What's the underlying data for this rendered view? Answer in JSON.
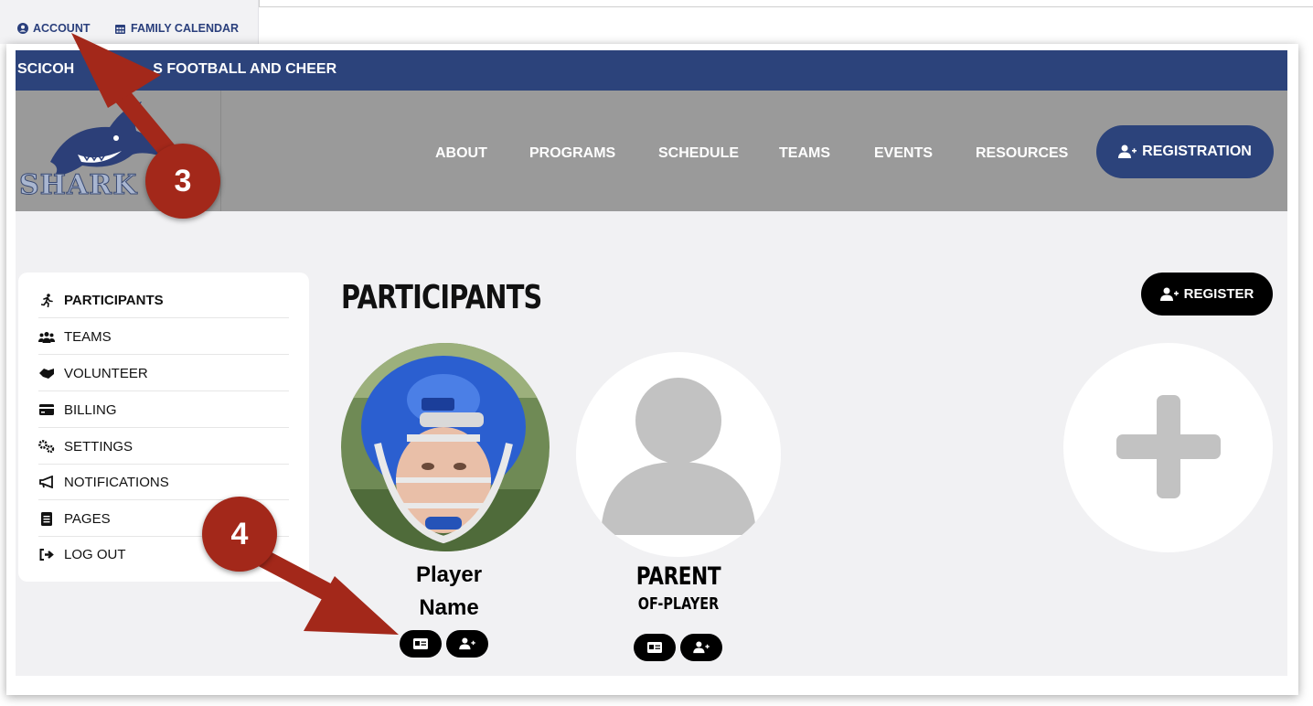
{
  "top_links": {
    "account": "ACCOUNT",
    "family_calendar": "FAMILY CALENDAR"
  },
  "banner": {
    "org_name_start": "SCICOH",
    "org_name_end": "S FOOTBALL AND CHEER"
  },
  "logo": {
    "text": "SHARK"
  },
  "nav": {
    "items": [
      "ABOUT",
      "PROGRAMS",
      "SCHEDULE",
      "TEAMS",
      "EVENTS",
      "RESOURCES"
    ],
    "registration_label": "REGISTRATION"
  },
  "sidebar": {
    "items": [
      {
        "label": "PARTICIPANTS",
        "icon": "running-icon"
      },
      {
        "label": "TEAMS",
        "icon": "users-icon"
      },
      {
        "label": "VOLUNTEER",
        "icon": "handshake-icon"
      },
      {
        "label": "BILLING",
        "icon": "credit-card-icon"
      },
      {
        "label": "SETTINGS",
        "icon": "gears-icon"
      },
      {
        "label": "NOTIFICATIONS",
        "icon": "megaphone-icon"
      },
      {
        "label": "PAGES",
        "icon": "file-icon"
      },
      {
        "label": "LOG OUT",
        "icon": "sign-out-icon"
      }
    ]
  },
  "main": {
    "title": "PARTICIPANTS",
    "register_label": "REGISTER",
    "participants": [
      {
        "name_line1": "Player",
        "name_line2": "Name"
      },
      {
        "name_line1": "PARENT",
        "name_line2": "OF-PLAYER"
      }
    ]
  },
  "callouts": {
    "account_step": "3",
    "card_step": "4"
  },
  "colors": {
    "brand_navy": "#2c437b",
    "nav_gray": "#9a9a9a",
    "callout_red": "#a3281a",
    "page_bg": "#f1f1f3"
  }
}
